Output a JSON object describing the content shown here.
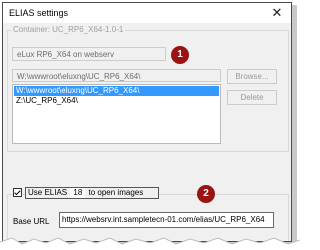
{
  "window": {
    "title": "ELIAS settings",
    "close_glyph": "✕"
  },
  "container": {
    "legend": "Container: UC_RP6_X64-1.0-1",
    "name_value": "eLux RP6_X64 on webserv"
  },
  "paths": {
    "source_value": "W:\\wwwroot\\eluxng\\UC_RP6_X64\\",
    "items": [
      {
        "label": "W:\\wwwroot\\eluxng\\UC_RP6_X64\\",
        "selected": true
      },
      {
        "label": "Z:\\UC_RP6_X64\\",
        "selected": false
      }
    ],
    "browse_label": "Browse...",
    "delete_label": "Delete"
  },
  "badges": {
    "first": "1",
    "second": "2",
    "color": "#9b1414"
  },
  "use_elias": {
    "checked": true,
    "label_pre": "Use  ELIAS",
    "version": "18",
    "label_post": " to open images"
  },
  "base_url": {
    "label": "Base URL",
    "value": "https://websrv.int.sampletecn-01.com/elias/UC_RP6_X64"
  },
  "colors": {
    "selection": "#3399ff",
    "badge": "#9b1414"
  }
}
